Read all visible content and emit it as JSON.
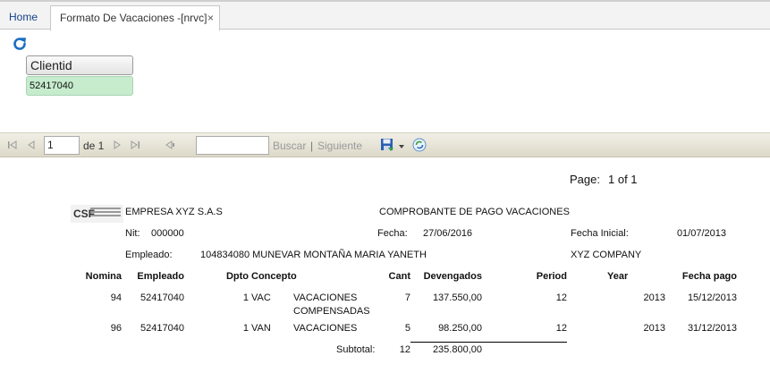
{
  "tabs": {
    "home": "Home",
    "active": "Formato De Vacaciones -[nrvc]",
    "close": "×"
  },
  "filter": {
    "label": "Clientid",
    "value": "52417040"
  },
  "toolbar": {
    "page": "1",
    "of_label": "de 1",
    "search_label": "Buscar",
    "separator": "|",
    "next_label": "Siguiente"
  },
  "report": {
    "page_label": "Page:",
    "page_value": "1 of 1",
    "company": "EMPRESA XYZ S.A.S",
    "title": "COMPROBANTE DE PAGO VACACIONES",
    "logo_text": "CSF",
    "nit_label": "Nit:",
    "nit_value": "000000",
    "fecha_label": "Fecha:",
    "fecha_value": "27/06/2016",
    "fecha_inicial_label": "Fecha Inicial:",
    "fecha_inicial_value": "01/07/2013",
    "empleado_label": "Empleado:",
    "empleado_value": "104834080 MUNEVAR MONTAÑA MARIA YANETH",
    "company_alt": "XYZ COMPANY",
    "columns": {
      "nomina": "Nomina",
      "empleado": "Empleado",
      "dpto": "Dpto",
      "concepto": "Concepto",
      "cant": "Cant",
      "devengados": "Devengados",
      "period": "Period",
      "year": "Year",
      "fecha_pago": "Fecha pago"
    },
    "rows": [
      {
        "nomina": "94",
        "empleado": "52417040",
        "dpto": "1",
        "codigo": "VAC",
        "concepto_1": "VACACIONES",
        "concepto_2": "COMPENSADAS",
        "cant": "7",
        "devengados": "137.550,00",
        "period": "12",
        "year": "2013",
        "fecha_pago": "15/12/2013"
      },
      {
        "nomina": "96",
        "empleado": "52417040",
        "dpto": "1",
        "codigo": "VAN",
        "concepto_1": "VACACIONES",
        "concepto_2": "",
        "cant": "5",
        "devengados": "98.250,00",
        "period": "12",
        "year": "2013",
        "fecha_pago": "31/12/2013"
      }
    ],
    "subtotal_label": "Subtotal:",
    "subtotal_cant": "12",
    "subtotal_value": "235.800,00"
  },
  "colors": {
    "accent": "#15428b",
    "param_value_bg": "#c6eccd",
    "toolbar_bg": "#e6e2d4"
  }
}
